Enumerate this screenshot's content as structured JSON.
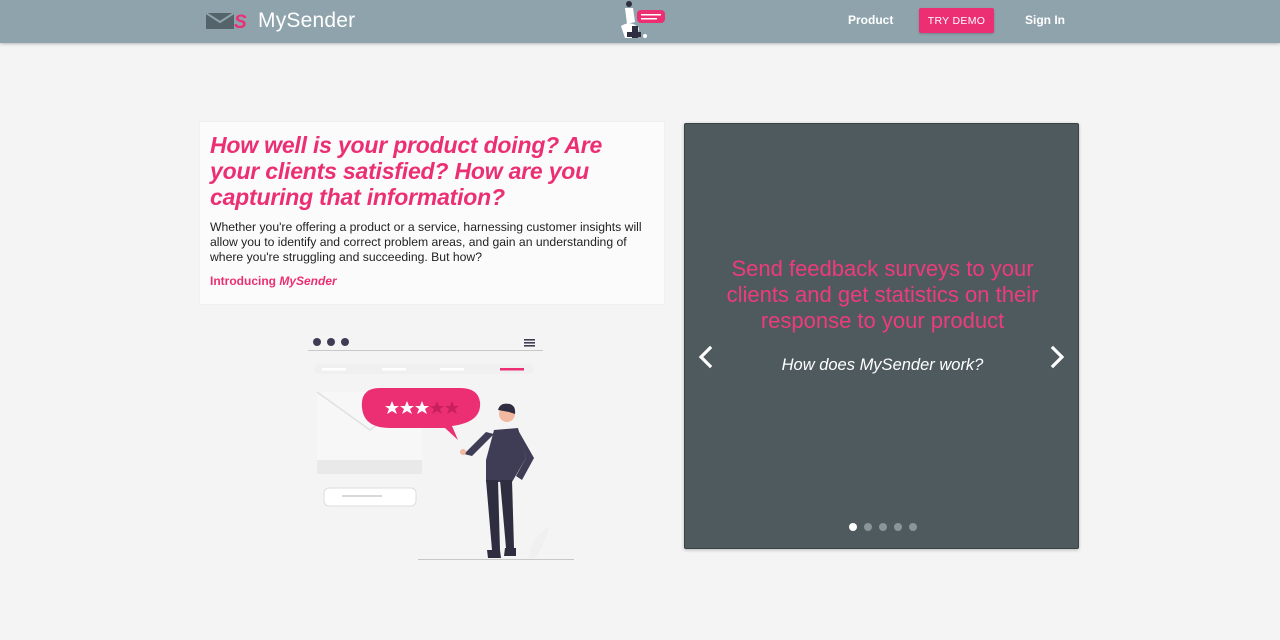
{
  "navbar": {
    "brand_name": "MySender",
    "logo_letter": "S",
    "product_label": "Product",
    "demo_label": "TRY DEMO",
    "signin_label": "Sign In"
  },
  "intro": {
    "heading": "How well is your product doing? Are your clients satisfied? How are you capturing that information?",
    "body": "Whether you're offering a product or a service, harnessing customer insights will allow you to identify and correct problem areas, and gain an understanding of where you're struggling and succeeding. But how?",
    "link_prefix": "Introducing ",
    "link_brand": "MySender"
  },
  "carousel": {
    "title": "Send feedback surveys to your clients and get statistics on their response to your product",
    "subtitle": "How does MySender work?",
    "slide_count": 5,
    "active_slide": 1
  },
  "colors": {
    "accent": "#ec2f73",
    "navbar": "#8fa3ad",
    "carousel_bg": "#4f5a5f",
    "page_bg": "#f4f4f4"
  },
  "icons": [
    "mail-logo-icon",
    "chevron-left-icon",
    "chevron-right-icon",
    "menu-icon",
    "star-icon"
  ]
}
